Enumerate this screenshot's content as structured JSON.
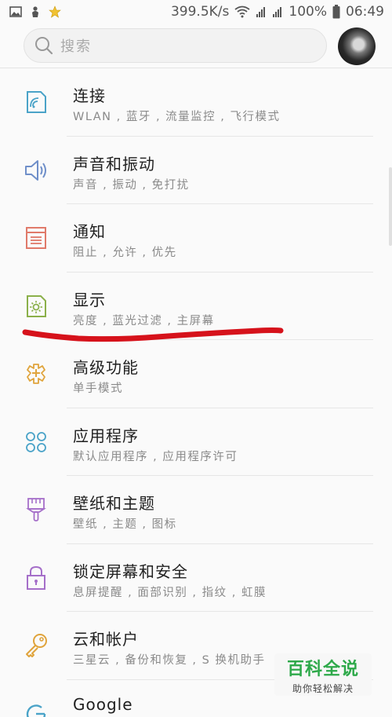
{
  "status_bar": {
    "network_speed": "399.5K/s",
    "battery": "100%",
    "time": "06:49",
    "icons": [
      "gallery-icon",
      "hand-icon",
      "star-icon",
      "wifi-icon",
      "signal-icon",
      "signal-icon",
      "battery-icon"
    ]
  },
  "search": {
    "placeholder": "搜索"
  },
  "items": [
    {
      "title": "连接",
      "subtitle": "WLAN , 蓝牙 , 流量监控 , 飞行模式",
      "icon": "connection-icon",
      "color": "#4aa3c8"
    },
    {
      "title": "声音和振动",
      "subtitle": "声音 , 振动 , 免打扰",
      "icon": "speaker-icon",
      "color": "#6f8fc9"
    },
    {
      "title": "通知",
      "subtitle": "阻止 , 允许 , 优先",
      "icon": "notification-icon",
      "color": "#e07a6a"
    },
    {
      "title": "显示",
      "subtitle": "亮度 , 蓝光过滤 , 主屏幕",
      "icon": "display-icon",
      "color": "#8bb04a"
    },
    {
      "title": "高级功能",
      "subtitle": "单手模式",
      "icon": "advanced-features-icon",
      "color": "#e0a43c"
    },
    {
      "title": "应用程序",
      "subtitle": "默认应用程序 , 应用程序许可",
      "icon": "apps-icon",
      "color": "#4aa3c8"
    },
    {
      "title": "壁纸和主题",
      "subtitle": "壁纸 , 主题 , 图标",
      "icon": "paintbrush-icon",
      "color": "#a56fc9"
    },
    {
      "title": "锁定屏幕和安全",
      "subtitle": "息屏提醒 , 面部识别 , 指纹 , 虹膜",
      "icon": "lock-icon",
      "color": "#a56fc9"
    },
    {
      "title": "云和帐户",
      "subtitle": "三星云 , 备份和恢复 , S 换机助手",
      "icon": "key-icon",
      "color": "#e0a43c"
    },
    {
      "title": "Google",
      "subtitle": "",
      "icon": "google-icon",
      "color": "#4aa3c8"
    }
  ],
  "watermark": {
    "title": "百科全说",
    "subtitle": "助你轻松解决"
  },
  "colors": {
    "annotation": "#d6121b",
    "background": "#fafafa"
  }
}
